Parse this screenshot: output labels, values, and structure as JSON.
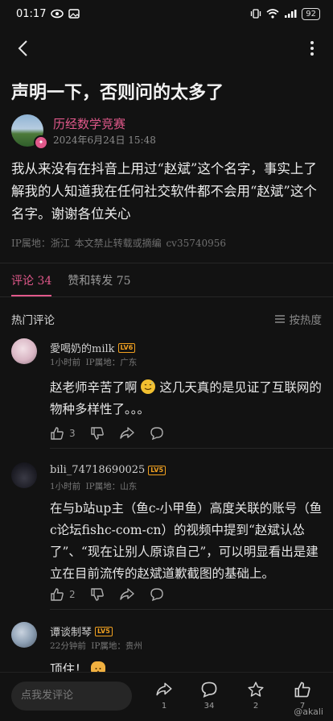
{
  "status_bar": {
    "time": "01:17",
    "battery": "92"
  },
  "post": {
    "title": "声明一下，否则问的太多了",
    "author_name": "历经数学竞赛",
    "timestamp": "2024年6月24日 15:48",
    "body": "我从来没有在抖音上用过“赵斌”这个名字，事实上了解我的人知道我在任何社交软件都不会用“赵斌”这个名字。谢谢各位关心",
    "meta": "IP属地：浙江   本文禁止转载或摘编   cv35740956"
  },
  "tabs": [
    {
      "label": "评论 34"
    },
    {
      "label": "赞和转发 75"
    }
  ],
  "sort": {
    "title": "热门评论",
    "button_label": "按热度"
  },
  "comments": [
    {
      "user": "愛喝奶的milk",
      "level": "LV6",
      "sub": "1小时前  IP属地：广东",
      "text_before": "赵老师辛苦了啊",
      "text_after": "这几天真的是见证了互联网的物种多样性了。。。",
      "likes": "3"
    },
    {
      "user": "bili_74718690025",
      "level": "LV5",
      "sub": "1小时前  IP属地：山东",
      "text": "在与b站up主（鱼c-小甲鱼）高度关联的账号（鱼c论坛fishc-com-cn）的视频中提到“赵斌认怂了”、“现在让别人原谅自己”，可以明显看出是建立在目前流传的赵斌道歉截图的基础上。",
      "likes": "2"
    },
    {
      "user": "谭谈制琴",
      "level": "LV5",
      "sub": "22分钟前  IP属地：贵州",
      "text": "顶住！"
    }
  ],
  "bottom_bar": {
    "input_placeholder": "点我发评论",
    "share_count": "1",
    "comment_count": "34",
    "fav_count": "2",
    "like_count": "7"
  },
  "watermark": "@akali",
  "colors": {
    "accent": "#e0588a",
    "background": "#121212",
    "level_badge": "#f0a020"
  }
}
